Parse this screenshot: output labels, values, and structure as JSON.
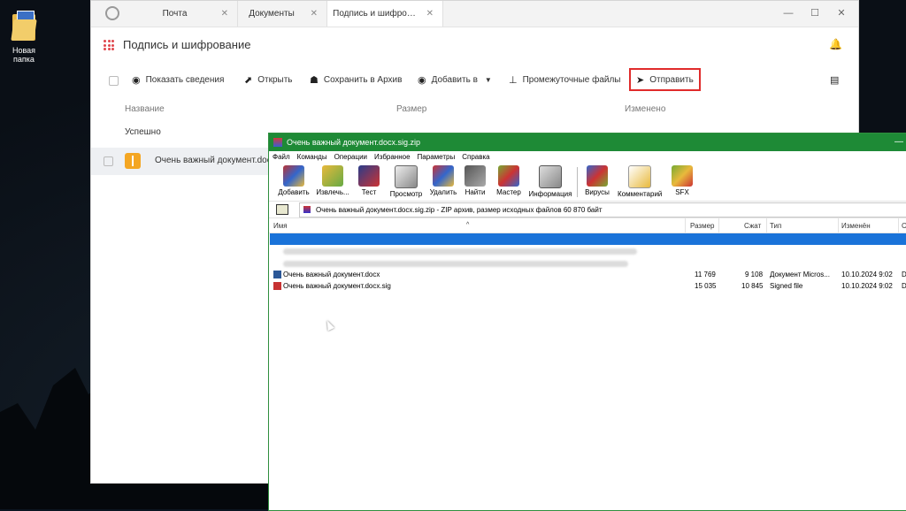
{
  "desktop": {
    "folder_label": "Новая папка"
  },
  "app": {
    "tabs": [
      {
        "label": "Почта",
        "close": "✕"
      },
      {
        "label": "Документы",
        "close": "✕"
      },
      {
        "label": "Подпись и шифро…",
        "close": "✕"
      }
    ],
    "window_controls": {
      "minimize": "—",
      "maximize": "☐",
      "close": "✕"
    },
    "title": "Подпись и шифрование",
    "toolbar": {
      "show_info": "Показать сведения",
      "open": "Открыть",
      "save_archive": "Сохранить в Архив",
      "add_to": "Добавить в",
      "intermediate": "Промежуточные файлы",
      "send": "Отправить"
    },
    "columns": {
      "name": "Название",
      "size": "Размер",
      "modified": "Изменено"
    },
    "group_label": "Успешно",
    "row": {
      "name": "Очень важный документ.docx"
    },
    "highlight_color": "#e02b2b"
  },
  "winrar": {
    "title": "Очень важный документ.docx.sig.zip",
    "menu": [
      "Файл",
      "Команды",
      "Операции",
      "Избранное",
      "Параметры",
      "Справка"
    ],
    "tools": [
      "Добавить",
      "Извлечь...",
      "Тест",
      "Просмотр",
      "Удалить",
      "Найти",
      "Мастер",
      "Информация",
      "Вирусы",
      "Комментарий",
      "SFX"
    ],
    "address": "Очень важный документ.docx.sig.zip - ZIP архив, размер исходных файлов 60 870 байт",
    "columns": {
      "name": "Имя",
      "size": "Размер",
      "packed": "Сжат",
      "type": "Тип",
      "modified": "Изменён",
      "crc": "C"
    },
    "files": [
      {
        "name": "Очень важный документ.docx",
        "size": "11 769",
        "packed": "9 108",
        "type": "Документ Micros...",
        "modified": "10.10.2024 9:02",
        "crc": "D"
      },
      {
        "name": "Очень важный документ.docx.sig",
        "size": "15 035",
        "packed": "10 845",
        "type": "Signed file",
        "modified": "10.10.2024 9:02",
        "crc": "D"
      }
    ],
    "accent_color": "#1e8a36"
  }
}
